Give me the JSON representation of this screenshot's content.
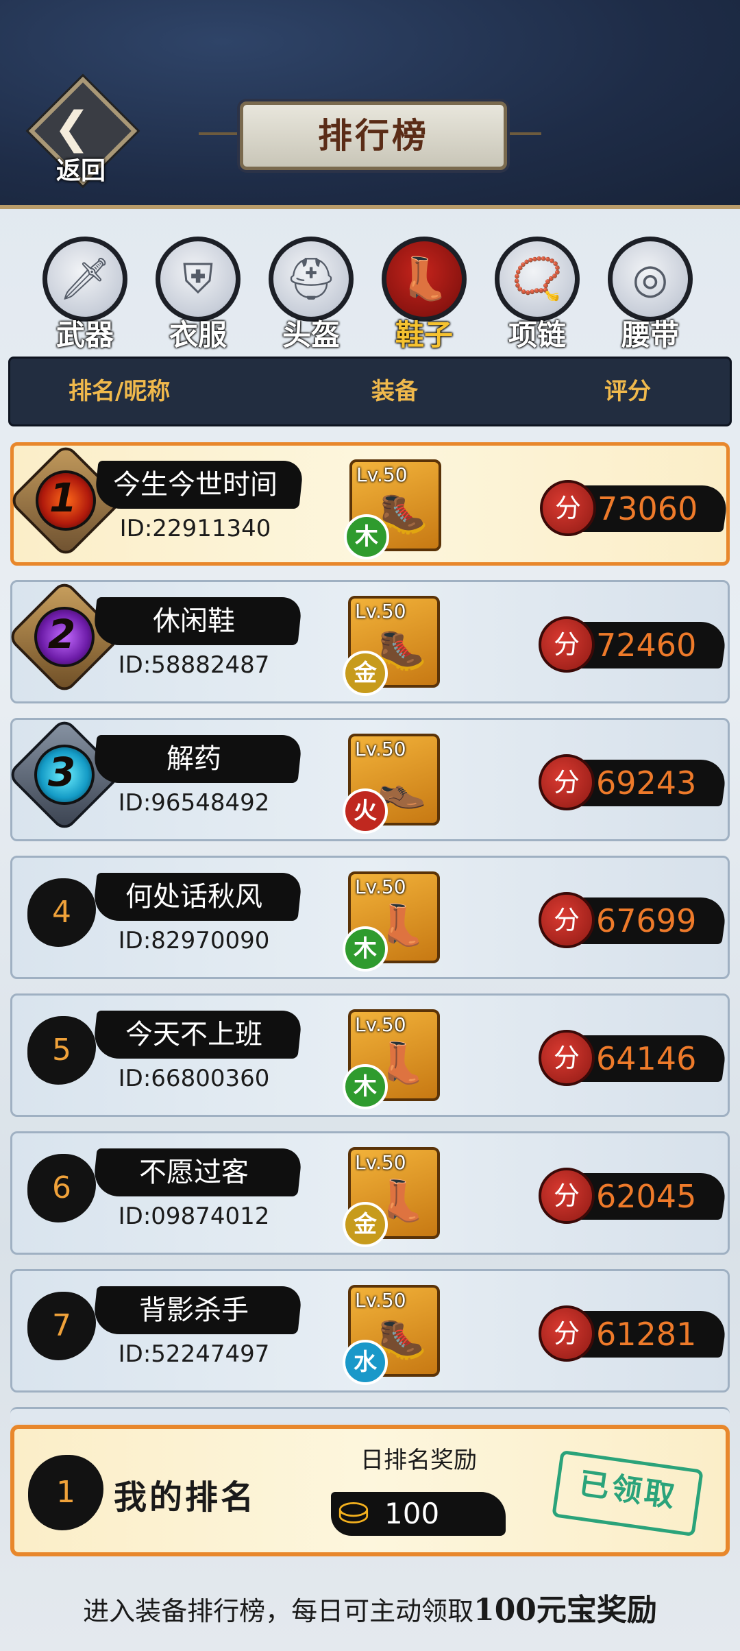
{
  "header": {
    "back_label": "返回",
    "title": "排行榜"
  },
  "categories": [
    {
      "label": "武器",
      "icon": "sword-icon",
      "active": false
    },
    {
      "label": "衣服",
      "icon": "armor-icon",
      "active": false
    },
    {
      "label": "头盔",
      "icon": "helmet-icon",
      "active": false
    },
    {
      "label": "鞋子",
      "icon": "boot-icon",
      "active": true
    },
    {
      "label": "项链",
      "icon": "necklace-icon",
      "active": false
    },
    {
      "label": "腰带",
      "icon": "belt-icon",
      "active": false
    }
  ],
  "columns": {
    "rank_name": "排名/昵称",
    "equipment": "装备",
    "score": "评分"
  },
  "score_icon_label": "分",
  "rows": [
    {
      "rank": "1",
      "name": "今生今世时间",
      "id": "ID:22911340",
      "level": "Lv.50",
      "element": "木",
      "element_color": "#2f9b2e",
      "score": "73060"
    },
    {
      "rank": "2",
      "name": "休闲鞋",
      "id": "ID:58882487",
      "level": "Lv.50",
      "element": "金",
      "element_color": "#c79b1c",
      "score": "72460"
    },
    {
      "rank": "3",
      "name": "解药",
      "id": "ID:96548492",
      "level": "Lv.50",
      "element": "火",
      "element_color": "#c0281f",
      "score": "69243"
    },
    {
      "rank": "4",
      "name": "何处话秋风",
      "id": "ID:82970090",
      "level": "Lv.50",
      "element": "木",
      "element_color": "#2f9b2e",
      "score": "67699"
    },
    {
      "rank": "5",
      "name": "今天不上班",
      "id": "ID:66800360",
      "level": "Lv.50",
      "element": "木",
      "element_color": "#2f9b2e",
      "score": "64146"
    },
    {
      "rank": "6",
      "name": "不愿过客",
      "id": "ID:09874012",
      "level": "Lv.50",
      "element": "金",
      "element_color": "#c79b1c",
      "score": "62045"
    },
    {
      "rank": "7",
      "name": "背影杀手",
      "id": "ID:52247497",
      "level": "Lv.50",
      "element": "水",
      "element_color": "#1a98c9",
      "score": "61281"
    }
  ],
  "my_rank": {
    "rank": "1",
    "label": "我的排名",
    "reward_title": "日排名奖励",
    "reward_amount": "100",
    "claimed_label": "已领取"
  },
  "footer": {
    "text": "进入装备排行榜，每日可主动领取",
    "highlight": "100元宝奖励"
  }
}
